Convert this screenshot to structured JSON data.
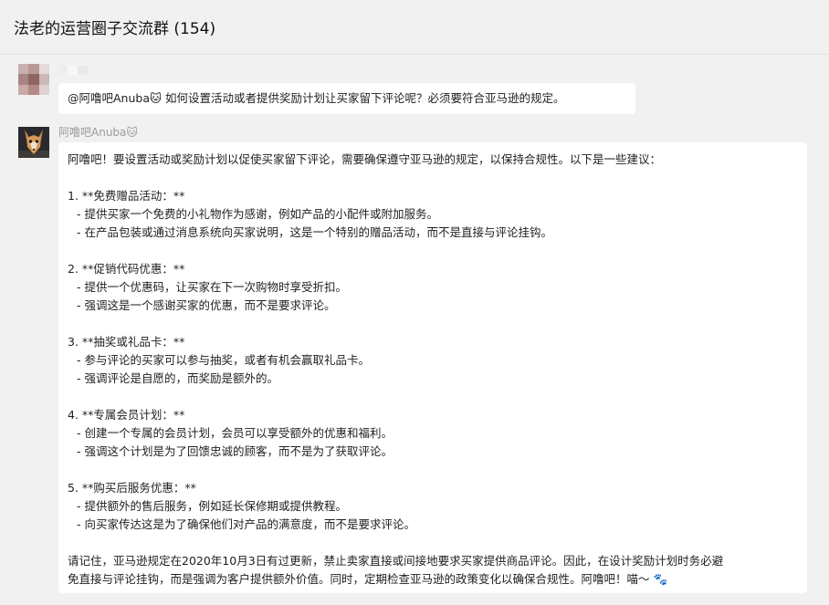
{
  "chat": {
    "title": "法老的运营圈子交流群 (154)"
  },
  "message1": {
    "text": "@阿噜吧Anuba🐱 如何设置活动或者提供奖励计划让买家留下评论呢？必须要符合亚马逊的规定。"
  },
  "message2": {
    "sender": "阿噜吧Anuba🐱",
    "intro": "阿噜吧！要设置活动或奖励计划以促使买家留下评论，需要确保遵守亚马逊的规定，以保持合规性。以下是一些建议：",
    "items": [
      {
        "heading": "1. **免费赠品活动：**",
        "points": [
          "- 提供买家一个免费的小礼物作为感谢，例如产品的小配件或附加服务。",
          "- 在产品包装或通过消息系统向买家说明，这是一个特别的赠品活动，而不是直接与评论挂钩。"
        ]
      },
      {
        "heading": "2. **促销代码优惠：**",
        "points": [
          "- 提供一个优惠码，让买家在下一次购物时享受折扣。",
          "- 强调这是一个感谢买家的优惠，而不是要求评论。"
        ]
      },
      {
        "heading": "3. **抽奖或礼品卡：**",
        "points": [
          "- 参与评论的买家可以参与抽奖，或者有机会赢取礼品卡。",
          "- 强调评论是自愿的，而奖励是额外的。"
        ]
      },
      {
        "heading": "4. **专属会员计划：**",
        "points": [
          "- 创建一个专属的会员计划，会员可以享受额外的优惠和福利。",
          "- 强调这个计划是为了回馈忠诚的顾客，而不是为了获取评论。"
        ]
      },
      {
        "heading": "5. **购买后服务优惠：**",
        "points": [
          "- 提供额外的售后服务，例如延长保修期或提供教程。",
          "- 向买家传达这是为了确保他们对产品的满意度，而不是要求评论。"
        ]
      }
    ],
    "closing_line1": "请记住，亚马逊规定在2020年10月3日有过更新，禁止卖家直接或间接地要求买家提供商品评论。因此，在设计奖励计划时务必避",
    "closing_line2": "免直接与评论挂钩，而是强调为客户提供额外价值。同时，定期检查亚马逊的政策变化以确保合规性。阿噜吧！喵～ 🐾"
  }
}
